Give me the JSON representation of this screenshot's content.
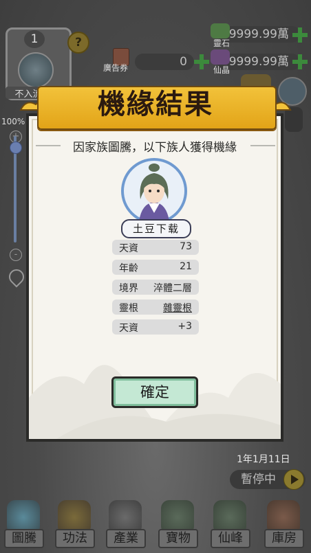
{
  "hud": {
    "clan_rank": "1",
    "clan_status": "不入流家族",
    "help": "?",
    "ad_ticket": {
      "label": "廣告券",
      "value": "0"
    },
    "spirit_stone": {
      "label": "靈石",
      "value": "9999.99萬"
    },
    "immortal_crystal": {
      "label": "仙晶",
      "value": "9999.99萬"
    },
    "zoom": "100%",
    "zoom_plus": "+",
    "zoom_minus": "-"
  },
  "dialog": {
    "title": "機緣結果",
    "subtitle": "因家族圖騰，以下族人獲得機緣",
    "character_name": "土豆下载",
    "stats": [
      {
        "key": "天資",
        "value": "73",
        "underline": false
      },
      {
        "key": "年齡",
        "value": "21",
        "underline": false
      },
      {
        "key": "境界",
        "value": "淬體二層",
        "underline": false
      },
      {
        "key": "靈根",
        "value": "雜靈根",
        "underline": true
      },
      {
        "key": "天資",
        "value": "+3",
        "underline": false
      }
    ],
    "confirm_label": "確定"
  },
  "game_clock": {
    "date": "1年1月11日",
    "pause_label": "暫停中"
  },
  "nav": [
    {
      "label": "圖騰",
      "icon": "totem-icon"
    },
    {
      "label": "功法",
      "icon": "technique-icon"
    },
    {
      "label": "產業",
      "icon": "industry-icon"
    },
    {
      "label": "寶物",
      "icon": "treasure-icon"
    },
    {
      "label": "仙峰",
      "icon": "peak-icon"
    },
    {
      "label": "庫房",
      "icon": "storehouse-icon"
    }
  ],
  "colors": {
    "banner_gold": "#f2c23a",
    "confirm_green": "#c4e8d4",
    "plus_green": "#3c8a3c",
    "dialog_bg": "#f6f4ee"
  }
}
